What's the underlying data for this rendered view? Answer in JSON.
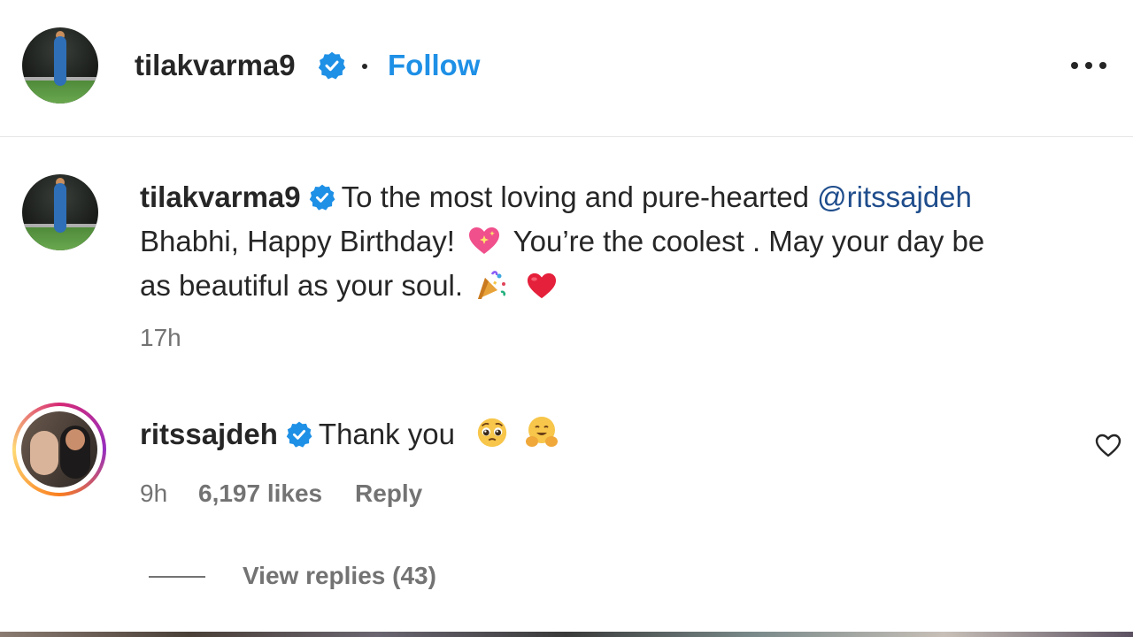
{
  "post": {
    "author": "tilakvarma9",
    "follow_label": "Follow",
    "caption_intro": "To the most loving and pure-hearted",
    "caption_mention": "@ritssajdeh",
    "caption_line2": "Bhabhi, Happy Birthday!",
    "caption_line2b": "You’re the coolest . May your day be",
    "caption_line3": "as beautiful as your soul.",
    "time": "17h"
  },
  "comment": {
    "author": "ritssajdeh",
    "text": "Thank you",
    "time": "9h",
    "likes": "6,197 likes",
    "reply_label": "Reply",
    "view_replies_label": "View replies (43)"
  },
  "icons": {
    "verified": "verified-badge-icon",
    "more": "more-options-icon",
    "like": "heart-outline-icon"
  },
  "colors": {
    "link": "#1e90e6",
    "mention": "#1f4d8c",
    "verified": "#1e90e6"
  }
}
